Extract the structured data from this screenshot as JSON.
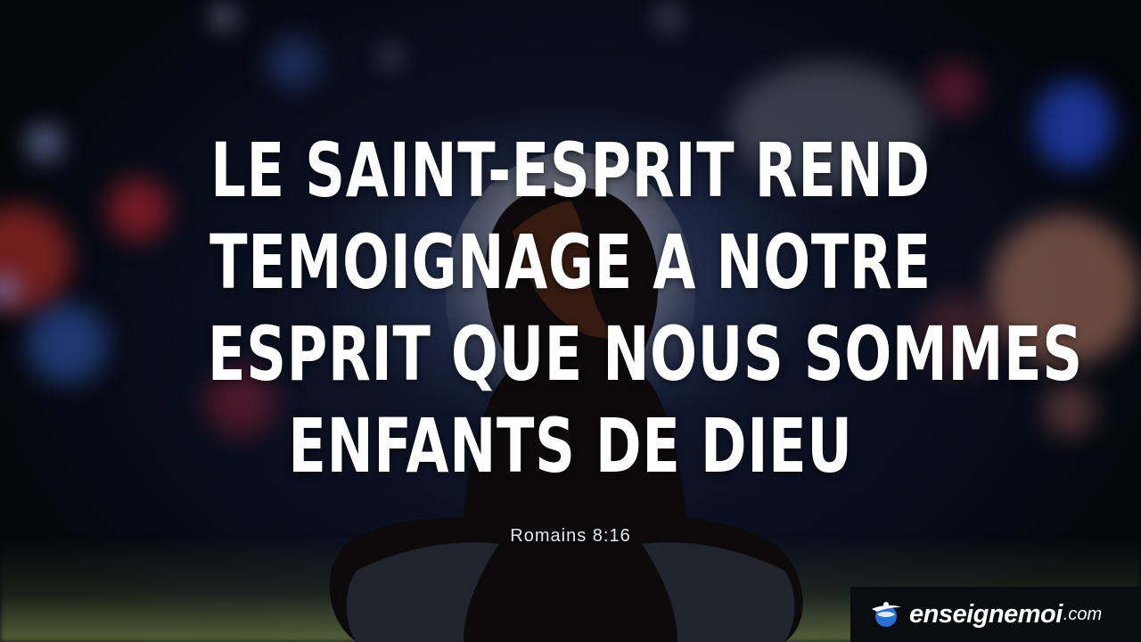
{
  "quote": {
    "lines": [
      "LE SAINT-ESPRIT REND",
      "TEMOIGNAGE A NOTRE",
      "ESPRIT QUE NOUS SOMMES",
      "ENFANTS DE DIEU"
    ],
    "reference": "Romains 8:16"
  },
  "brand": {
    "name": "enseignemoi",
    "tld": ".com",
    "logo_icon": "globe-swoosh-icon"
  },
  "colors": {
    "text": "#ffffff",
    "badge_background": "#0b0c10",
    "logo_blue": "#2a6fd6"
  }
}
